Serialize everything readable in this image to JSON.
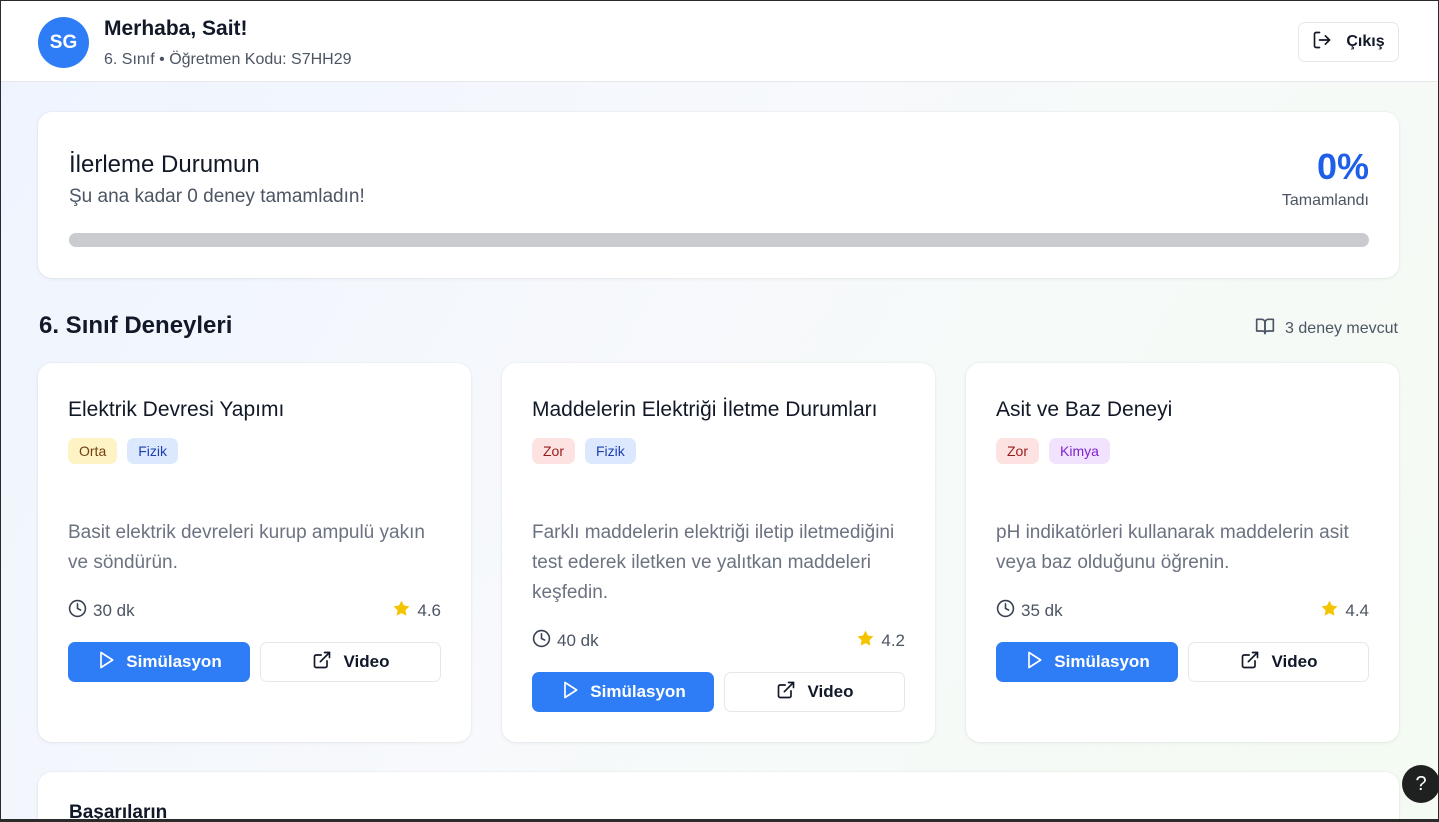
{
  "header": {
    "avatar_initials": "SG",
    "greeting": "Merhaba, Sait!",
    "grade": "6. Sınıf",
    "separator": " • ",
    "teacher_code": "Öğretmen Kodu: S7HH29",
    "logout_label": "Çıkış"
  },
  "progress": {
    "title": "İlerleme Durumun",
    "subtitle": "Şu ana kadar 0 deney tamamladın!",
    "percent_text": "0%",
    "percent_value": 0,
    "percent_label": "Tamamlandı",
    "bar_color": "#2f7df6"
  },
  "section": {
    "title": "6. Sınıf Deneyleri",
    "count_text": "3 deney mevcut"
  },
  "experiments": [
    {
      "title": "Elektrik Devresi Yapımı",
      "difficulty": "Orta",
      "subject": "Fizik",
      "description": "Basit elektrik devreleri kurup ampulü yakın ve söndürün.",
      "duration": "30 dk",
      "rating": "4.6",
      "sim_label": "Simülasyon",
      "video_label": "Video"
    },
    {
      "title": "Maddelerin Elektriği İletme Durumları",
      "difficulty": "Zor",
      "subject": "Fizik",
      "description": "Farklı maddelerin elektriği iletip iletmediğini test ederek iletken ve yalıtkan maddeleri keşfedin.",
      "duration": "40 dk",
      "rating": "4.2",
      "sim_label": "Simülasyon",
      "video_label": "Video"
    },
    {
      "title": "Asit ve Baz Deneyi",
      "difficulty": "Zor",
      "subject": "Kimya",
      "description": "pH indikatörleri kullanarak maddelerin asit veya baz olduğunu öğrenin.",
      "duration": "35 dk",
      "rating": "4.4",
      "sim_label": "Simülasyon",
      "video_label": "Video"
    }
  ],
  "achievements": {
    "title": "Başarıların"
  },
  "help": {
    "label": "?"
  },
  "colors": {
    "accent": "#2f7df6",
    "percent": "#1d5fe8",
    "star": "#f5c400"
  }
}
